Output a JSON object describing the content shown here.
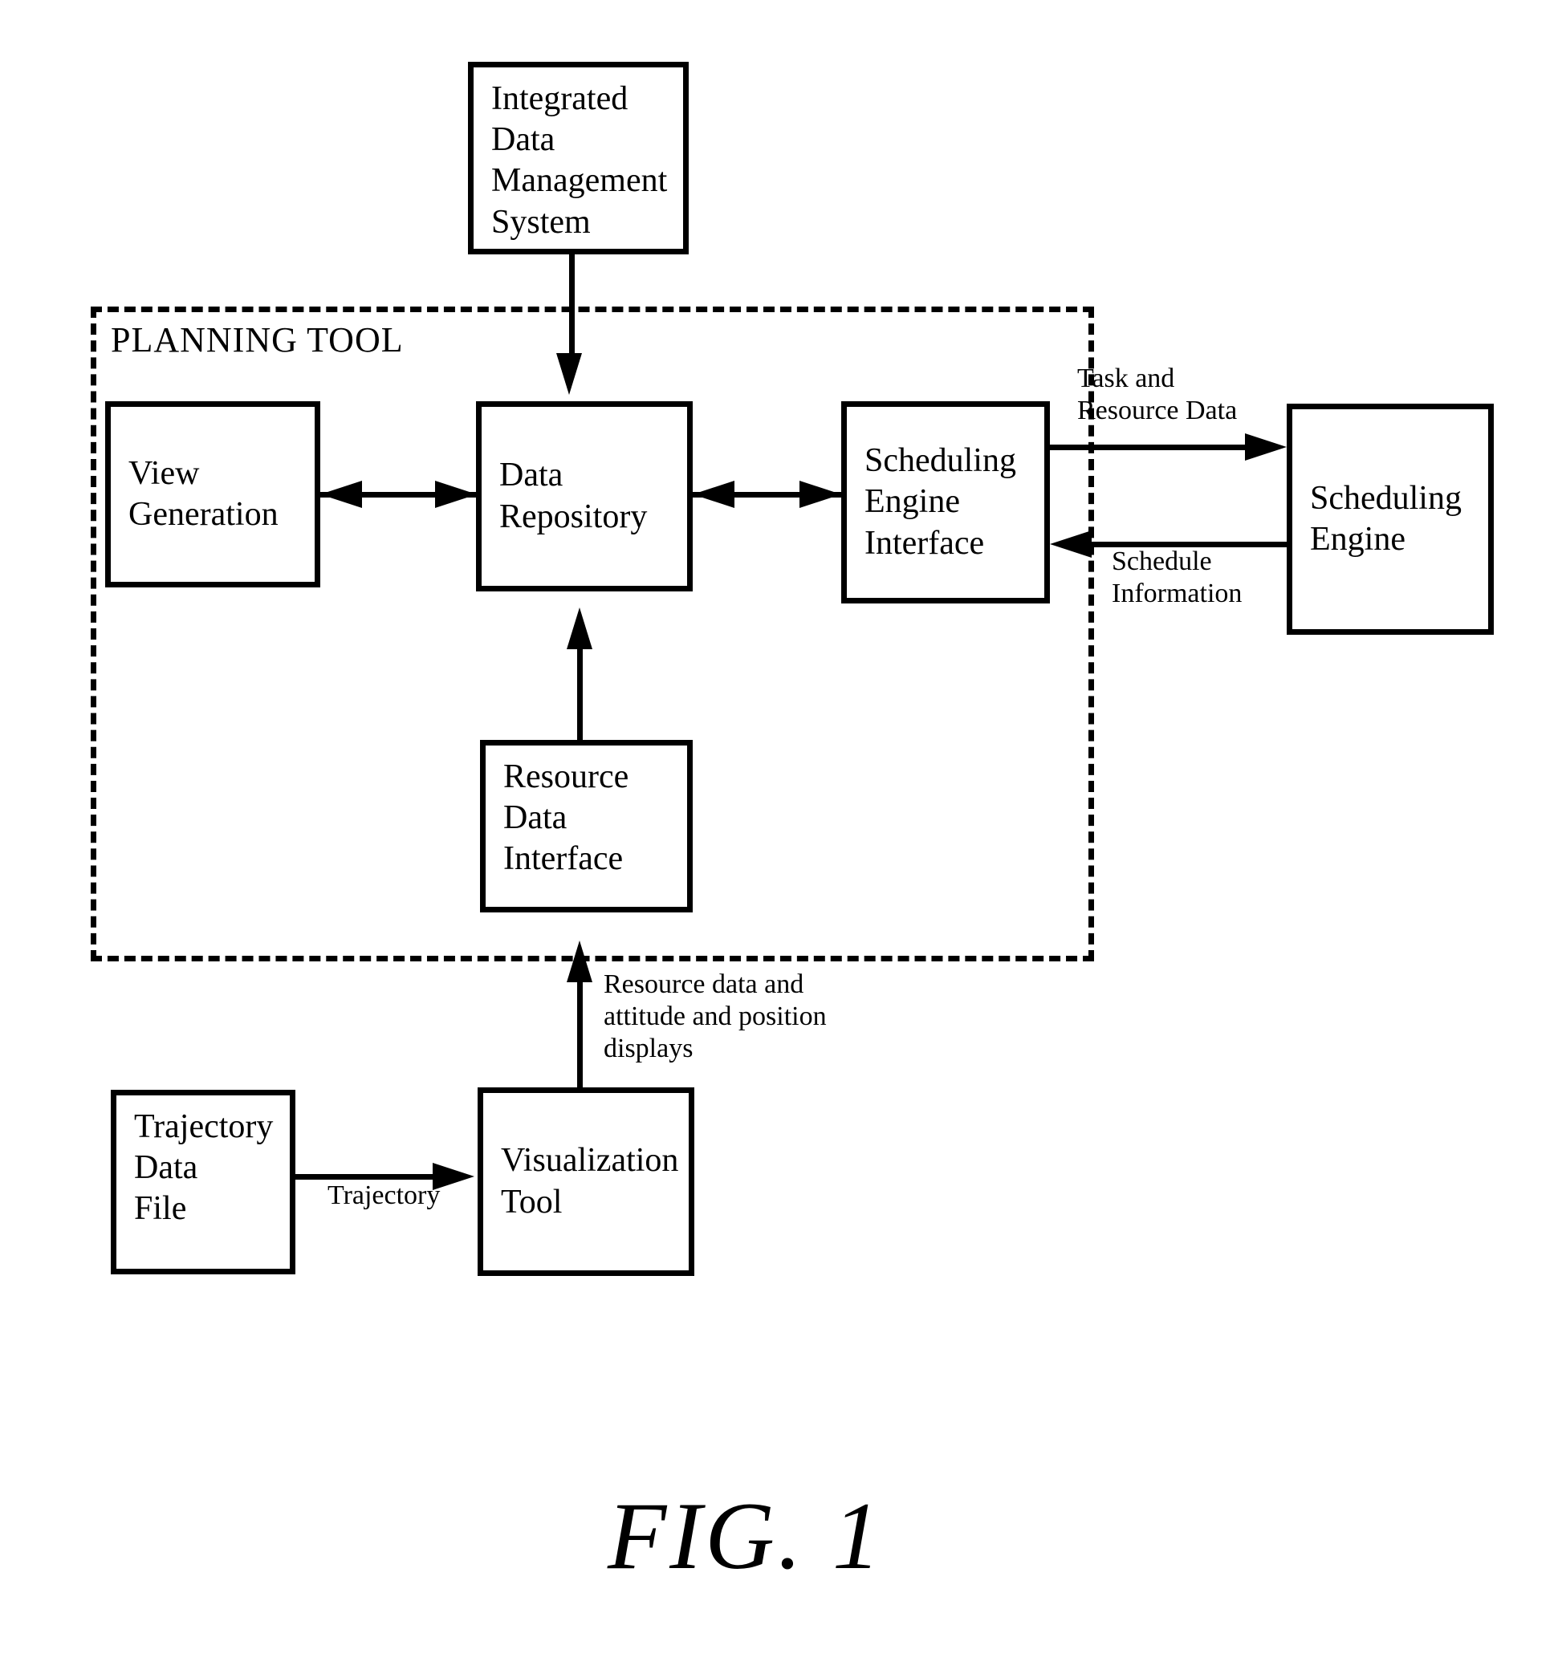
{
  "figure": {
    "caption": "FIG. 1",
    "group_label": "PLANNING TOOL"
  },
  "nodes": {
    "idms": "Integrated\nData\nManagement\nSystem",
    "view_generation": "View\nGeneration",
    "data_repository": "Data\nRepository",
    "scheduling_engine_interface": "Scheduling\nEngine\nInterface",
    "scheduling_engine": "Scheduling\nEngine",
    "resource_data_interface": "Resource\nData\nInterface",
    "trajectory_data_file": "Trajectory\nData\nFile",
    "visualization_tool": "Visualization\nTool"
  },
  "edge_labels": {
    "task_and_resource_data": "Task and\nResource Data",
    "schedule_information": "Schedule\nInformation",
    "resource_data_displays": "Resource data and\nattitude and position\ndisplays",
    "trajectory": "Trajectory"
  },
  "chart_data": {
    "type": "diagram",
    "title": "FIG. 1",
    "boundary_group": "PLANNING TOOL",
    "blocks": [
      {
        "id": "idms",
        "label": "Integrated Data Management System",
        "inside_planning_tool": false
      },
      {
        "id": "view_generation",
        "label": "View Generation",
        "inside_planning_tool": true
      },
      {
        "id": "data_repository",
        "label": "Data Repository",
        "inside_planning_tool": true
      },
      {
        "id": "scheduling_engine_interface",
        "label": "Scheduling Engine Interface",
        "inside_planning_tool": true
      },
      {
        "id": "resource_data_interface",
        "label": "Resource Data Interface",
        "inside_planning_tool": true
      },
      {
        "id": "scheduling_engine",
        "label": "Scheduling Engine",
        "inside_planning_tool": false
      },
      {
        "id": "trajectory_data_file",
        "label": "Trajectory Data File",
        "inside_planning_tool": false
      },
      {
        "id": "visualization_tool",
        "label": "Visualization Tool",
        "inside_planning_tool": false
      }
    ],
    "connections": [
      {
        "from": "idms",
        "to": "data_repository",
        "direction": "one-way",
        "label": ""
      },
      {
        "from": "view_generation",
        "to": "data_repository",
        "direction": "two-way",
        "label": ""
      },
      {
        "from": "data_repository",
        "to": "scheduling_engine_interface",
        "direction": "two-way",
        "label": ""
      },
      {
        "from": "scheduling_engine_interface",
        "to": "scheduling_engine",
        "direction": "one-way",
        "label": "Task and Resource Data"
      },
      {
        "from": "scheduling_engine",
        "to": "scheduling_engine_interface",
        "direction": "one-way",
        "label": "Schedule Information"
      },
      {
        "from": "resource_data_interface",
        "to": "data_repository",
        "direction": "one-way",
        "label": ""
      },
      {
        "from": "visualization_tool",
        "to": "resource_data_interface",
        "direction": "one-way",
        "label": "Resource data and attitude and position displays"
      },
      {
        "from": "trajectory_data_file",
        "to": "visualization_tool",
        "direction": "one-way",
        "label": "Trajectory"
      }
    ]
  }
}
